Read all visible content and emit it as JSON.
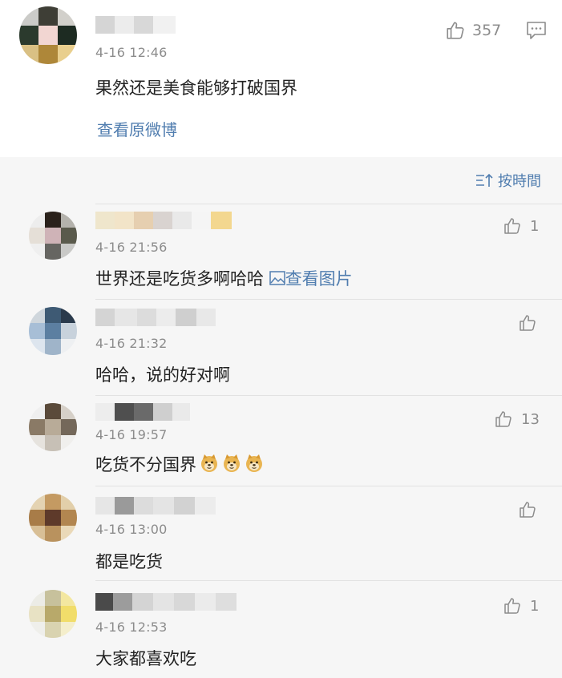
{
  "post": {
    "time": "4-16 12:46",
    "text": "果然还是美食能够打破国界",
    "likes": "357",
    "view_original": "查看原微博"
  },
  "comments": {
    "sort_label": "按時間",
    "items": [
      {
        "time": "4-16 21:56",
        "text": "世界还是吃货多啊哈哈",
        "view_image": "查看图片",
        "likes": "1"
      },
      {
        "time": "4-16 21:32",
        "text": "哈哈，说的好对啊",
        "likes": ""
      },
      {
        "time": "4-16 19:57",
        "text": "吃货不分国界",
        "likes": "13"
      },
      {
        "time": "4-16 13:00",
        "text": "都是吃货",
        "likes": ""
      },
      {
        "time": "4-16 12:53",
        "text": "大家都喜欢吃",
        "likes": "1"
      }
    ]
  },
  "colors": {
    "link": "#507daf",
    "secondary_text": "#8c8c8c",
    "comment_background": "#f6f6f6"
  },
  "icons": [
    "thumbs-up-icon",
    "comment-icon",
    "sort-icon",
    "image-icon",
    "doge-emoji-icon"
  ]
}
